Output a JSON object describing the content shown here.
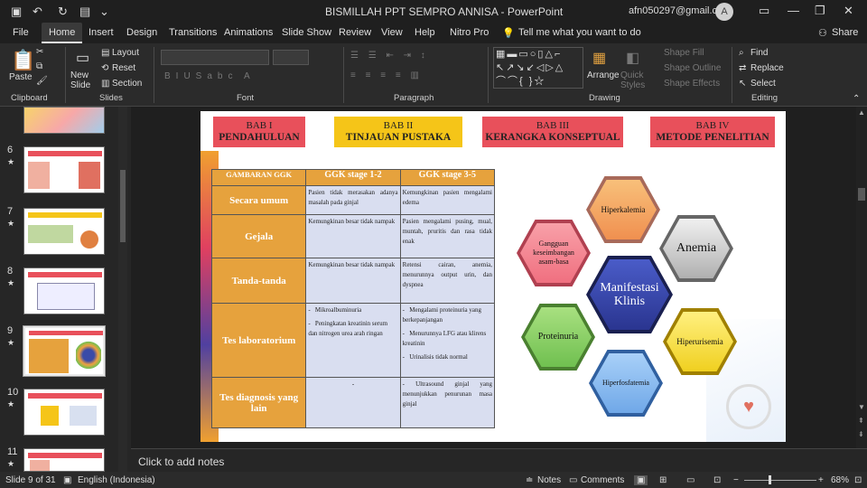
{
  "titlebar": {
    "title": "BISMILLAH PPT SEMPRO ANNISA  -  PowerPoint",
    "account": "afn050297@gmail.com",
    "avatar": "A"
  },
  "tabs": [
    "File",
    "Home",
    "Insert",
    "Design",
    "Transitions",
    "Animations",
    "Slide Show",
    "Review",
    "View",
    "Help",
    "Nitro Pro"
  ],
  "tell_me": "Tell me what you want to do",
  "share": "Share",
  "ribbon": {
    "clipboard": {
      "paste": "Paste",
      "group": "Clipboard"
    },
    "slides": {
      "new_slide": "New Slide",
      "layout": "Layout",
      "reset": "Reset",
      "section": "Section",
      "group": "Slides"
    },
    "font": {
      "group": "Font"
    },
    "paragraph": {
      "group": "Paragraph"
    },
    "drawing": {
      "arrange": "Arrange",
      "quick_styles": "Quick Styles",
      "shape_fill": "Shape Fill",
      "shape_outline": "Shape Outline",
      "shape_effects": "Shape Effects",
      "group": "Drawing"
    },
    "editing": {
      "find": "Find",
      "replace": "Replace",
      "select": "Select",
      "group": "Editing"
    }
  },
  "thumbnails": [
    {
      "num": "6",
      "star": "★"
    },
    {
      "num": "7",
      "star": "★"
    },
    {
      "num": "8",
      "star": "★"
    },
    {
      "num": "9",
      "star": "★"
    },
    {
      "num": "10",
      "star": "★"
    },
    {
      "num": "11",
      "star": "★"
    }
  ],
  "slide": {
    "babs": [
      {
        "num": "BAB I",
        "title": "PENDAHULUAN",
        "bg": "#e8505b"
      },
      {
        "num": "BAB II",
        "title": "TINJAUAN PUSTAKA",
        "bg": "#f5c518"
      },
      {
        "num": "BAB III",
        "title": "KERANGKA KONSEPTUAL",
        "bg": "#e8505b"
      },
      {
        "num": "BAB IV",
        "title": "METODE PENELITIAN",
        "bg": "#e8505b"
      }
    ],
    "table": {
      "headers": [
        "GAMBARAN GGK",
        "GGK stage 1-2",
        "GGK stage 3-5"
      ],
      "rows": [
        {
          "label": "Secara umum",
          "a": "Pasien tidak merasakan adanya masalah pada ginjal",
          "b": "Kemungkinan pasien mengalami edema"
        },
        {
          "label": "Gejala",
          "a": "Kemungkinan besar tidak nampak",
          "b": "Pasien mengalami pusing, mual, muntah, pruritis dan rasa tidak enak"
        },
        {
          "label": "Tanda-tanda",
          "a": "Kemungkinan besar tidak nampak",
          "b": "Retensi cairan, anemia, menurunnya output urin, dan dyspnea"
        },
        {
          "label": "Tes laboratorium",
          "a_list": [
            "Mikroalbuminuria",
            "Peningkatan kreatinin serum dan nitrogen urea arah ringan"
          ],
          "b_list": [
            "Mengalami proteinuria yang berkepanjangan",
            "Menurunnya LFG atau klirens kreatinin",
            "Urinalisis tidak normal"
          ]
        },
        {
          "label": "Tes diagnosis yang lain",
          "a": "-",
          "b": "- Ultrasound ginjal yang menunjukkan penurunan masa ginjal"
        }
      ]
    },
    "hexes": {
      "center": "Manifestasi Klinis",
      "hiperkalemia": "Hiperkalemia",
      "anemia": "Anemia",
      "gangguan": "Gangguan keseimbangan asam-basa",
      "proteinuria": "Proteinuria",
      "hiperurisemia": "Hiperurisemia",
      "hiperfosfatemia": "Hiperfosfatemia"
    }
  },
  "notes_placeholder": "Click to add notes",
  "status": {
    "slide_info": "Slide 9 of 31",
    "language": "English (Indonesia)",
    "notes": "Notes",
    "comments": "Comments",
    "zoom": "68%"
  }
}
